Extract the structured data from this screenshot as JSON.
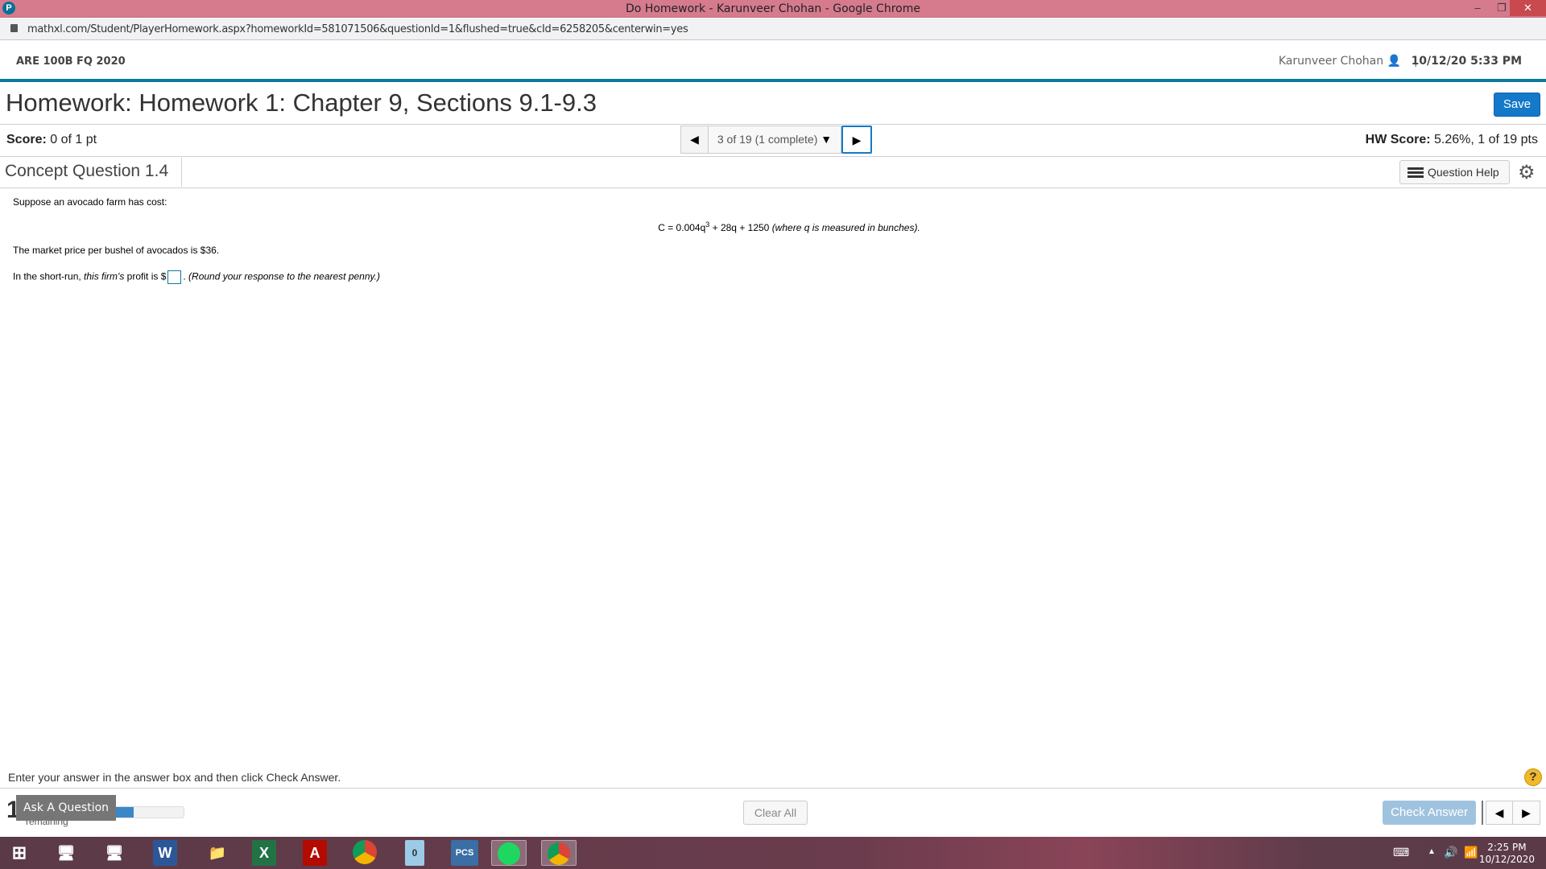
{
  "window": {
    "title": "Do Homework - Karunveer Chohan - Google Chrome",
    "url": "mathxl.com/Student/PlayerHomework.aspx?homeworkId=581071506&questionId=1&flushed=true&cId=6258205&centerwin=yes"
  },
  "header": {
    "course": "ARE 100B FQ 2020",
    "user": "Karunveer Chohan",
    "separator": "|",
    "datetime": "10/12/20 5:33 PM"
  },
  "homework": {
    "title": "Homework: Homework 1: Chapter 9, Sections 9.1-9.3",
    "save_label": "Save",
    "score_label": "Score:",
    "score_value": "0 of 1 pt",
    "nav_label": "3 of 19 (1 complete)",
    "hw_score_label": "HW Score:",
    "hw_score_value": "5.26%, 1 of 19 pts"
  },
  "question": {
    "title": "Concept Question 1.4",
    "help_label": "Question Help",
    "line1": "Suppose an avocado farm has cost:",
    "formula_prefix": "C = 0.004q",
    "formula_exp": "3",
    "formula_rest": " + 28q + 1250 ",
    "formula_note": "(where q is measured in bunches).",
    "line2": "The market price per bushel of avocados is $36.",
    "line3_a": "In the short-run, ",
    "line3_b": "this firm's",
    "line3_c": " profit is $",
    "line3_d": ". ",
    "line3_e": "(Round your response to the nearest penny.)",
    "answer_value": ""
  },
  "footer": {
    "instruction": "Enter your answer in the answer box and then click Check Answer.",
    "help_symbol": "?",
    "remaining_number": "1",
    "remaining_label": "remaining",
    "progress_fraction": 0.7,
    "ask_label": "Ask A Question",
    "clear_label": "Clear All",
    "check_label": "Check Answer"
  },
  "taskbar": {
    "time": "2:25 PM",
    "date": "10/12/2020",
    "apps": [
      "start",
      "network",
      "remote-desktop",
      "word",
      "file-explorer",
      "excel",
      "acrobat",
      "chrome",
      "calculator",
      "pcs",
      "spotify",
      "chrome-active"
    ]
  }
}
